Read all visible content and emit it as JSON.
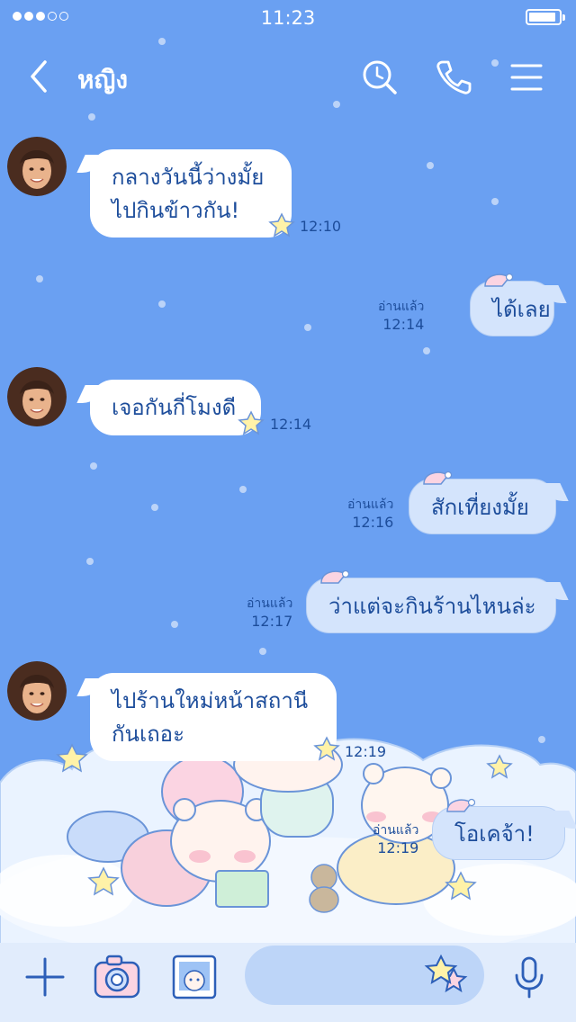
{
  "status_bar": {
    "time": "11:23",
    "signal_dots_filled": 3,
    "signal_dots_total": 5,
    "battery_level": 0.9
  },
  "header": {
    "contact_name": "หญิง",
    "back_icon": "chevron-left-icon",
    "search_icon": "clock-search-icon",
    "call_icon": "phone-icon",
    "menu_icon": "hamburger-icon"
  },
  "messages": [
    {
      "side": "in",
      "lines": [
        "กลางวันนี้ว่างมั้ย",
        "ไปกินข้าวกัน!"
      ],
      "time": "12:10"
    },
    {
      "side": "out",
      "lines": [
        "ได้เลย"
      ],
      "read": "อ่านแล้ว",
      "time": "12:14"
    },
    {
      "side": "in",
      "lines": [
        "เจอกันกี่โมงดี"
      ],
      "time": "12:14"
    },
    {
      "side": "out",
      "lines": [
        "สักเที่ยงมั้ย"
      ],
      "read": "อ่านแล้ว",
      "time": "12:16"
    },
    {
      "side": "out",
      "lines": [
        "ว่าแต่จะกินร้านไหนล่ะ"
      ],
      "read": "อ่านแล้ว",
      "time": "12:17"
    },
    {
      "side": "in",
      "lines": [
        "ไปร้านใหม่หน้าสถานี",
        "กันเถอะ"
      ],
      "time": "12:19"
    },
    {
      "side": "out",
      "lines": [
        "โอเคจ้า!"
      ],
      "read": "อ่านแล้ว",
      "time": "12:19"
    }
  ],
  "input_bar": {
    "add_icon": "plus-icon",
    "camera_icon": "camera-icon",
    "gallery_icon": "photo-icon",
    "sticker_icon": "star-sticker-icon",
    "mic_icon": "microphone-icon"
  },
  "colors": {
    "background": "#6aa0f2",
    "incoming_bubble": "#ffffff",
    "outgoing_bubble": "#d4e4fc",
    "text": "#1d4d9b",
    "input_bar": "#e1ecfc"
  }
}
